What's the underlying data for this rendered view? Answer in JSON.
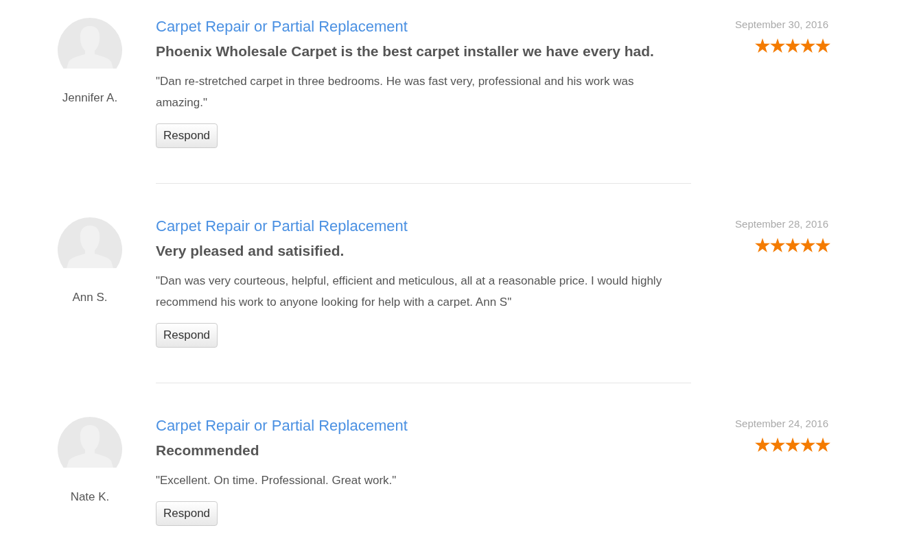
{
  "reviews": [
    {
      "reviewer": "Jennifer A.",
      "service": "Carpet Repair or Partial Replacement",
      "headline": "Phoenix Wholesale Carpet is the best carpet installer we have every had.",
      "text": "\"Dan re-stretched carpet in three bedrooms. He was fast very, professional and his work was amazing.\"",
      "button": "Respond",
      "date": "September 30, 2016",
      "stars": 5
    },
    {
      "reviewer": "Ann S.",
      "service": "Carpet Repair or Partial Replacement",
      "headline": "Very pleased and satisified.",
      "text": "\"Dan was very courteous, helpful, efficient and meticulous, all at a reasonable price. I would highly recommend his work to anyone looking for help with a carpet. Ann S\"",
      "button": "Respond",
      "date": "September 28, 2016",
      "stars": 5
    },
    {
      "reviewer": "Nate K.",
      "service": "Carpet Repair or Partial Replacement",
      "headline": "Recommended",
      "text": "\"Excellent. On time. Professional. Great work.\"",
      "button": "Respond",
      "date": "September 24, 2016",
      "stars": 5
    }
  ]
}
